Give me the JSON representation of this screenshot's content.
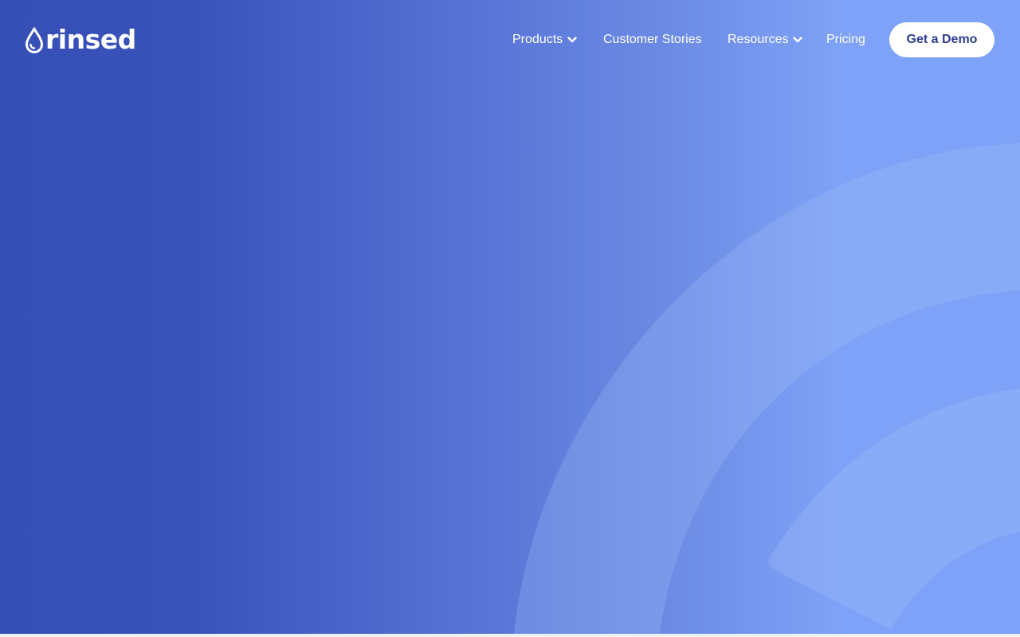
{
  "brand": {
    "name": "rinsed"
  },
  "nav": {
    "items": [
      {
        "label": "Products",
        "has_dropdown": true
      },
      {
        "label": "Customer Stories",
        "has_dropdown": false
      },
      {
        "label": "Resources",
        "has_dropdown": true
      },
      {
        "label": "Pricing",
        "has_dropdown": false
      }
    ],
    "cta_label": "Get a Demo"
  },
  "icons": {
    "logo": "water-drop-icon",
    "dropdown": "chevron-down-icon"
  },
  "colors": {
    "gradient_start": "#364fb6",
    "gradient_end": "#7ea2f7",
    "ring": "#a6bff8",
    "cta_text": "#2c3f8f",
    "nav_text": "#ffffff"
  }
}
